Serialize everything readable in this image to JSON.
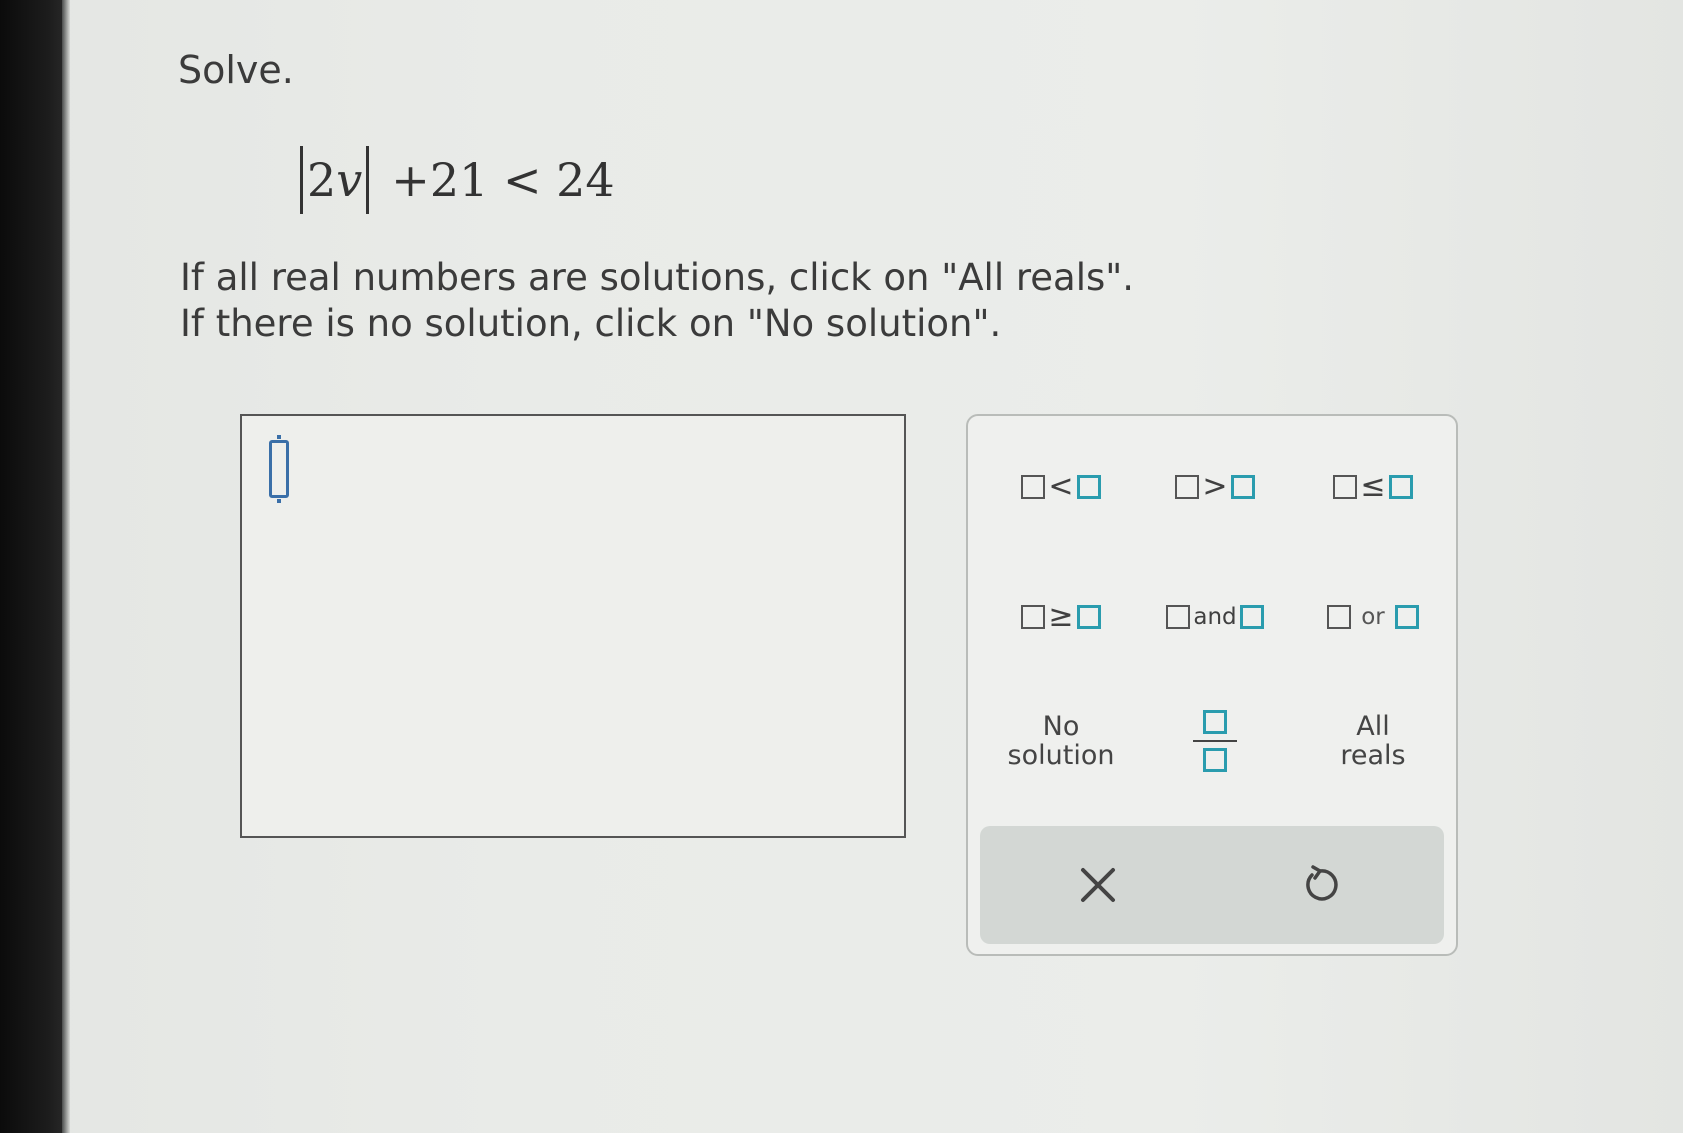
{
  "problem": {
    "heading": "Solve.",
    "equation": {
      "coefficient": "2",
      "variable": "v",
      "rest": "+21 < 24"
    },
    "instruction_all_reals": "If all real numbers are solutions, click on \"All reals\".",
    "instruction_no_solution": "If there is no solution, click on \"No solution\"."
  },
  "keypad": {
    "less_than": "<",
    "greater_than": ">",
    "less_equal": "≤",
    "greater_equal": "≥",
    "and": "and",
    "or": "or",
    "no_solution_line1": "No",
    "no_solution_line2": "solution",
    "all_reals_line1": "All",
    "all_reals_line2": "reals",
    "clear_icon": "close-icon",
    "undo_icon": "undo-icon"
  },
  "colors": {
    "teal_box": "#2a9cae",
    "cursor": "#3a6fa8",
    "action_bar": "#d3d7d4"
  }
}
